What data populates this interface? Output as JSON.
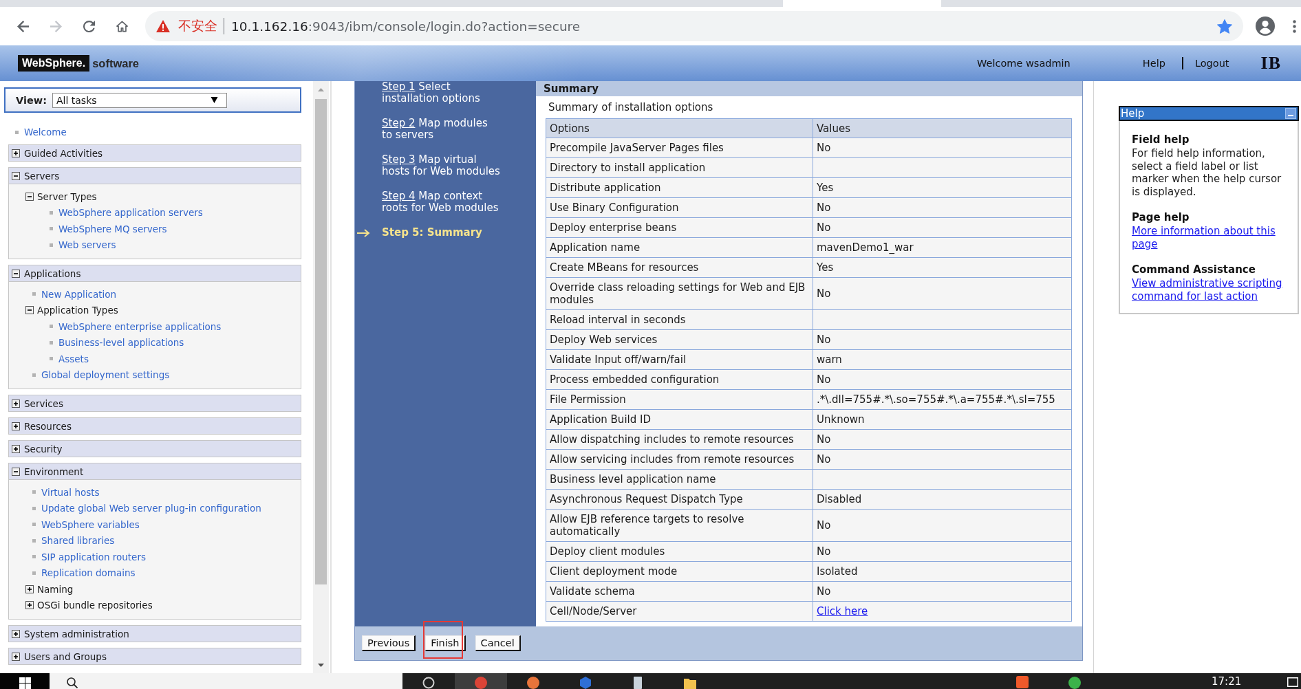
{
  "browser": {
    "nav_buttons": [
      {
        "kind": "back",
        "disabled": false
      },
      {
        "kind": "forward",
        "disabled": true
      },
      {
        "kind": "reload",
        "disabled": false
      },
      {
        "kind": "home",
        "disabled": false
      }
    ],
    "security_label": "不安全",
    "url_host": "10.1.162.16",
    "url_rest": ":9043/ibm/console/login.do?action=secure",
    "bookmarked": true
  },
  "header": {
    "logo_brand": "WebSphere.",
    "logo_product": "software",
    "welcome": "Welcome wsadmin",
    "links": [
      "Help",
      "Logout"
    ],
    "vendor_logo": "IB"
  },
  "navigation": {
    "view_label": "View:",
    "view_value": "All tasks",
    "items": [
      {
        "kind": "link",
        "label": "Welcome"
      },
      {
        "kind": "section",
        "label": "Guided Activities",
        "expanded": false
      },
      {
        "kind": "section",
        "label": "Servers",
        "expanded": true,
        "children": [
          {
            "kind": "group",
            "label": "Server Types",
            "expanded": true,
            "children": [
              {
                "kind": "link",
                "label": "WebSphere application servers"
              },
              {
                "kind": "link",
                "label": "WebSphere MQ servers"
              },
              {
                "kind": "link",
                "label": "Web servers"
              }
            ]
          }
        ]
      },
      {
        "kind": "section",
        "label": "Applications",
        "expanded": true,
        "children": [
          {
            "kind": "link",
            "label": "New Application"
          },
          {
            "kind": "group",
            "label": "Application Types",
            "expanded": true,
            "children": [
              {
                "kind": "link",
                "label": "WebSphere enterprise applications"
              },
              {
                "kind": "link",
                "label": "Business-level applications"
              },
              {
                "kind": "link",
                "label": "Assets"
              }
            ]
          },
          {
            "kind": "link",
            "label": "Global deployment settings"
          }
        ]
      },
      {
        "kind": "section",
        "label": "Services",
        "expanded": false
      },
      {
        "kind": "section",
        "label": "Resources",
        "expanded": false
      },
      {
        "kind": "section",
        "label": "Security",
        "expanded": false
      },
      {
        "kind": "section",
        "label": "Environment",
        "expanded": true,
        "children": [
          {
            "kind": "link",
            "label": "Virtual hosts"
          },
          {
            "kind": "link",
            "label": "Update global Web server plug-in configuration"
          },
          {
            "kind": "link",
            "label": "WebSphere variables"
          },
          {
            "kind": "link",
            "label": "Shared libraries"
          },
          {
            "kind": "link",
            "label": "SIP application routers"
          },
          {
            "kind": "link",
            "label": "Replication domains"
          },
          {
            "kind": "group",
            "label": "Naming",
            "expanded": false
          },
          {
            "kind": "group",
            "label": "OSGi bundle repositories",
            "expanded": false
          }
        ]
      },
      {
        "kind": "section",
        "label": "System administration",
        "expanded": false
      },
      {
        "kind": "section",
        "label": "Users and Groups",
        "expanded": false
      }
    ]
  },
  "wizard": {
    "steps": [
      {
        "label": "Step 1",
        "title": "Select\ninstallation options",
        "selected": false
      },
      {
        "label": "Step 2",
        "title": "Map modules\nto servers",
        "selected": false
      },
      {
        "label": "Step 3",
        "title": "Map virtual\nhosts for Web modules",
        "selected": false
      },
      {
        "label": "Step 4",
        "title": "Map context\nroots for Web modules",
        "selected": false
      },
      {
        "label": "Step 5: Summary",
        "selected": true
      }
    ],
    "section_title": "Summary",
    "caption": "Summary of installation options",
    "columns": [
      "Options",
      "Values"
    ],
    "rows": [
      {
        "kind": "text",
        "option": "Precompile JavaServer Pages files",
        "value": "No"
      },
      {
        "kind": "text",
        "option": "Directory to install application"
      },
      {
        "kind": "text",
        "option": "Distribute application",
        "value": "Yes"
      },
      {
        "kind": "text",
        "option": "Use Binary Configuration",
        "value": "No"
      },
      {
        "kind": "text",
        "option": "Deploy enterprise beans",
        "value": "No"
      },
      {
        "kind": "text",
        "option": "Application name",
        "value": "mavenDemo1_war"
      },
      {
        "kind": "text",
        "option": "Create MBeans for resources",
        "value": "Yes"
      },
      {
        "kind": "text",
        "option": "Override class reloading settings for Web and EJB modules",
        "value": "No"
      },
      {
        "kind": "text",
        "option": "Reload interval in seconds"
      },
      {
        "kind": "text",
        "option": "Deploy Web services",
        "value": "No"
      },
      {
        "kind": "text",
        "option": "Validate Input off/warn/fail",
        "value": "warn"
      },
      {
        "kind": "text",
        "option": "Process embedded configuration",
        "value": "No"
      },
      {
        "kind": "text",
        "option": "File Permission",
        "value": ".*\\.dll=755#.*\\.so=755#.*\\.a=755#.*\\.sl=755"
      },
      {
        "kind": "text",
        "option": "Application Build ID",
        "value": "Unknown"
      },
      {
        "kind": "text",
        "option": "Allow dispatching includes to remote resources",
        "value": "No"
      },
      {
        "kind": "text",
        "option": "Allow servicing includes from remote resources",
        "value": "No"
      },
      {
        "kind": "text",
        "option": "Business level application name"
      },
      {
        "kind": "text",
        "option": "Asynchronous Request Dispatch Type",
        "value": "Disabled"
      },
      {
        "kind": "text",
        "option": "Allow EJB reference targets to resolve automatically",
        "value": "No"
      },
      {
        "kind": "text",
        "option": "Deploy client modules",
        "value": "No"
      },
      {
        "kind": "text",
        "option": "Client deployment mode",
        "value": "Isolated"
      },
      {
        "kind": "text",
        "option": "Validate schema",
        "value": "No"
      },
      {
        "kind": "link",
        "option": "Cell/Node/Server",
        "value": "Click here"
      }
    ],
    "buttons": [
      {
        "label": "Previous",
        "highlighted": false
      },
      {
        "label": "Finish",
        "highlighted": true
      },
      {
        "label": "Cancel",
        "highlighted": false
      }
    ]
  },
  "help": {
    "title": "Help",
    "sections": [
      {
        "kind": "text",
        "heading": "Field help",
        "text": "For field help information, select a field label or list marker when the help cursor is displayed."
      },
      {
        "kind": "link",
        "heading": "Page help",
        "text": "More information about this page"
      },
      {
        "kind": "link",
        "heading": "Command Assistance",
        "text": "View administrative scripting command for last action"
      }
    ]
  },
  "taskbar": {
    "apps": [
      {
        "active": false
      },
      {
        "active": true
      },
      {
        "active": false
      },
      {
        "active": false
      },
      {
        "active": false
      },
      {
        "active": false
      }
    ],
    "clock": "17:21"
  }
}
